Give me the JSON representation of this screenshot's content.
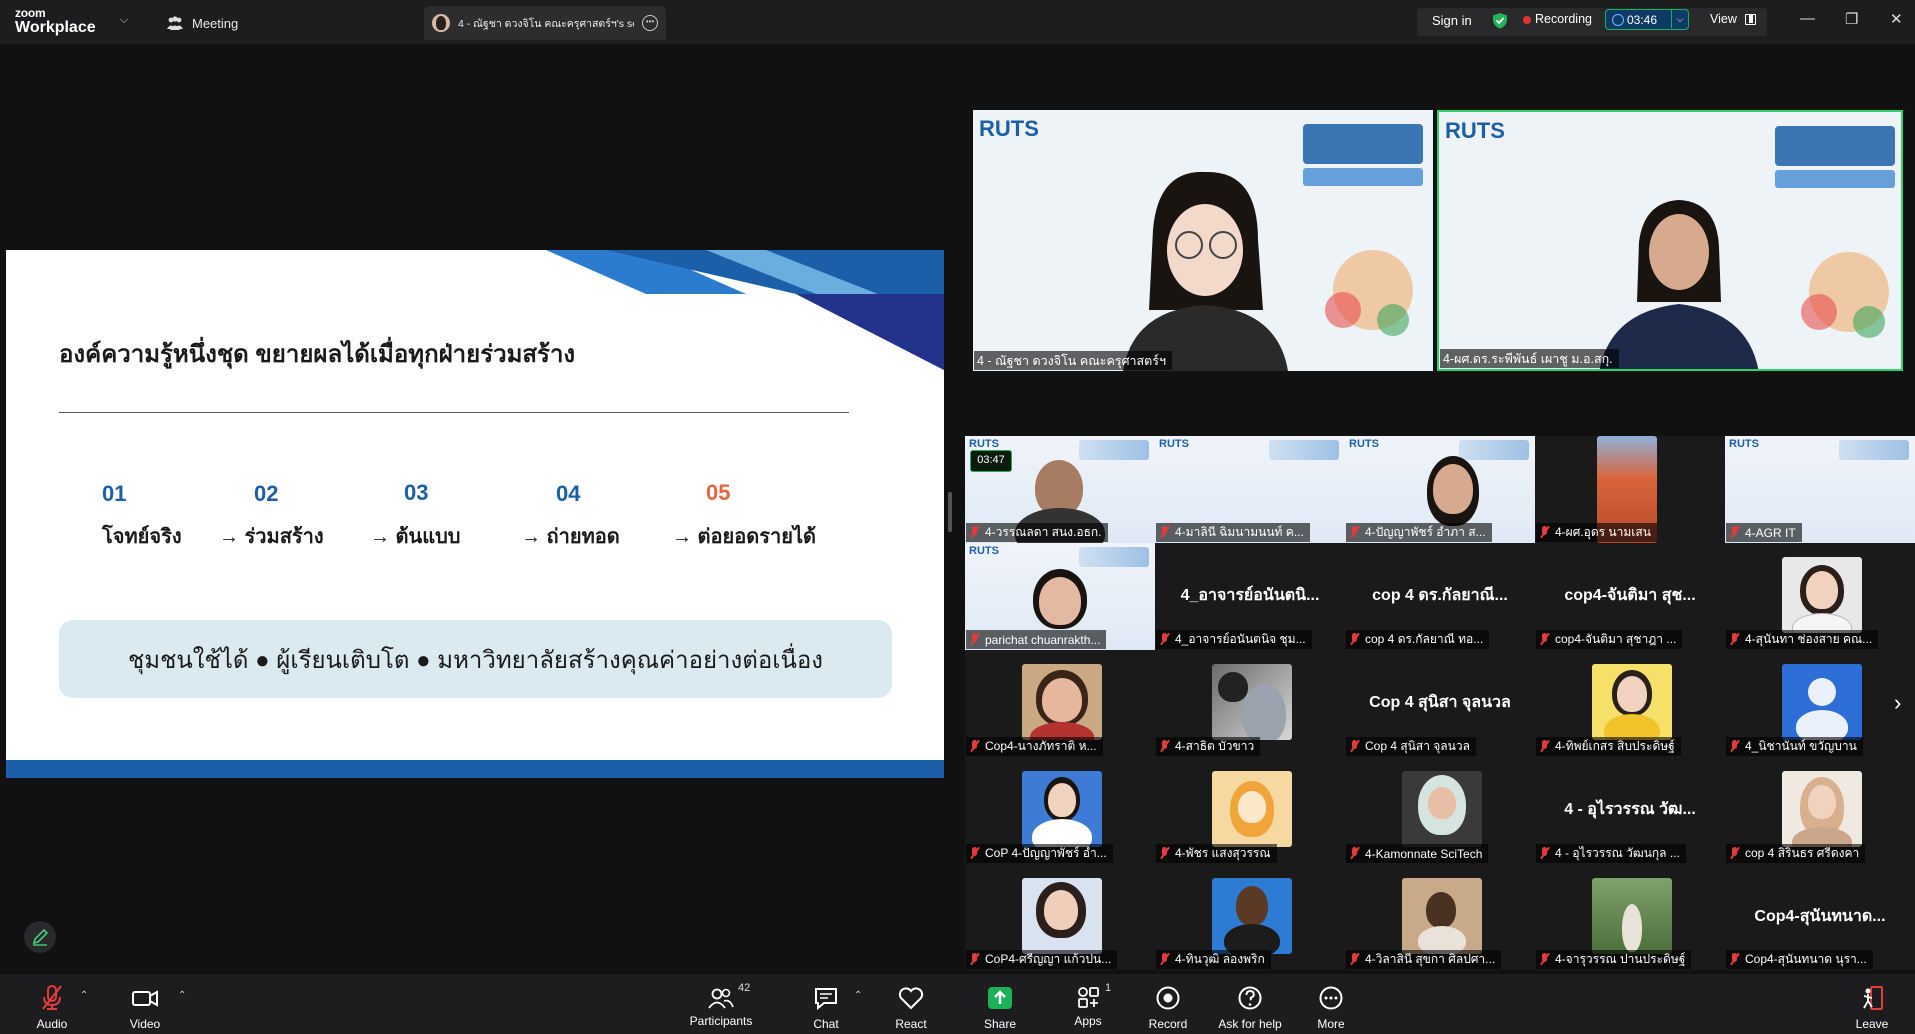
{
  "app": {
    "brand_line1": "zoom",
    "brand_line2": "Workplace"
  },
  "header": {
    "meeting_tab": "Meeting",
    "active_tab_title": "4 - ณัฐชา ดวงจิโน คณะครุศาสตร์ฯ's sc",
    "sign_in": "Sign in",
    "recording": "Recording",
    "timer": "03:46",
    "view": "View"
  },
  "slide": {
    "title": "องค์ความรู้หนึ่งชุด ขยายผลได้เมื่อทุกฝ่ายร่วมสร้าง",
    "steps": [
      {
        "num": "01",
        "label": "โจทย์จริง"
      },
      {
        "num": "02",
        "label": "→ ร่วมสร้าง"
      },
      {
        "num": "03",
        "label": "→ ต้นแบบ"
      },
      {
        "num": "04",
        "label": "→ ถ่ายทอด"
      },
      {
        "num": "05",
        "label": "→ ต่อยอดรายได้"
      }
    ],
    "banner": "ชุมชนใช้ได้ ● ผู้เรียนเติบโต ● มหาวิทยาลัยสร้างคุณค่าอย่างต่อเนื่อง",
    "accent_blue": "#1b5fa8",
    "accent_orange": "#e8663d"
  },
  "videos": {
    "big": [
      {
        "name": "4 - ณัฐชา ดวงจิโน คณะครุศาสตร์ฯ"
      },
      {
        "name": "4-ผศ.ดร.ระพีพันธ์ เผาชู ม.อ.สกุ."
      }
    ],
    "grid": [
      {
        "name": "4-วรรณลดา  สนง.อธก.",
        "small_timer": "03:47"
      },
      {
        "name": "4-มาลินี ฉิมนามนนท์ ค..."
      },
      {
        "name": "4-ปัญญาพัชร์ อำภา ส..."
      },
      {
        "name": "4-ผศ.อุดร นามเสน"
      },
      {
        "name": "4-AGR IT"
      },
      {
        "name": "parichat chuanrakth..."
      },
      {
        "name": "4_อาจารย์อนันตนิจ ชุม...",
        "big": "4_อาจารย์อนันตนิ..."
      },
      {
        "name": "cop 4 ดร.กัลยาณี  ทอ...",
        "big": "cop 4 ดร.กัลยาณี..."
      },
      {
        "name": "cop4-จันติมา สุชาฎา ...",
        "big": "cop4-จันติมา สุช..."
      },
      {
        "name": "4-สุนันทา ช่องสาย คณ..."
      },
      {
        "name": "Cop4-นางภัทราติ  ห..."
      },
      {
        "name": "4-สาธิต บัวขาว"
      },
      {
        "name": "Cop 4 สุนิสา จุลนวล",
        "big": "Cop 4 สุนิสา จุลนวล"
      },
      {
        "name": "4-ทิพย์เกสร สิบประดิษฐ์"
      },
      {
        "name": "4_นิชานันท์ ขวัญบาน"
      },
      {
        "name": "CoP 4-ปัญญาพัชร์ อำ..."
      },
      {
        "name": "4-พัชร แสงสุวรรณ"
      },
      {
        "name": "4-Kamonnate SciTech"
      },
      {
        "name": "4 - อุไรวรรณ วัฒนกุล ...",
        "big": "4 - อุไรวรรณ วัฒ..."
      },
      {
        "name": "cop 4 สิรินธร ศรีดงคา"
      },
      {
        "name": "CoP4-ศรีญญา แก้วปน..."
      },
      {
        "name": "4-ทินวุฒิ ลองพริก"
      },
      {
        "name": "4-วิลาสินี สุขกา ศิลปศา..."
      },
      {
        "name": "4-จารุวรรณ ปานประดิษฐ์"
      },
      {
        "name": "Cop4-สุนันทนาด นุรา...",
        "big": "Cop4-สุนันทนาด..."
      }
    ]
  },
  "toolbar": {
    "audio": "Audio",
    "video": "Video",
    "participants": "Participants",
    "participants_count": "42",
    "chat": "Chat",
    "react": "React",
    "share": "Share",
    "apps": "Apps",
    "apps_count": "1",
    "record": "Record",
    "help": "Ask for help",
    "more": "More",
    "leave": "Leave"
  }
}
